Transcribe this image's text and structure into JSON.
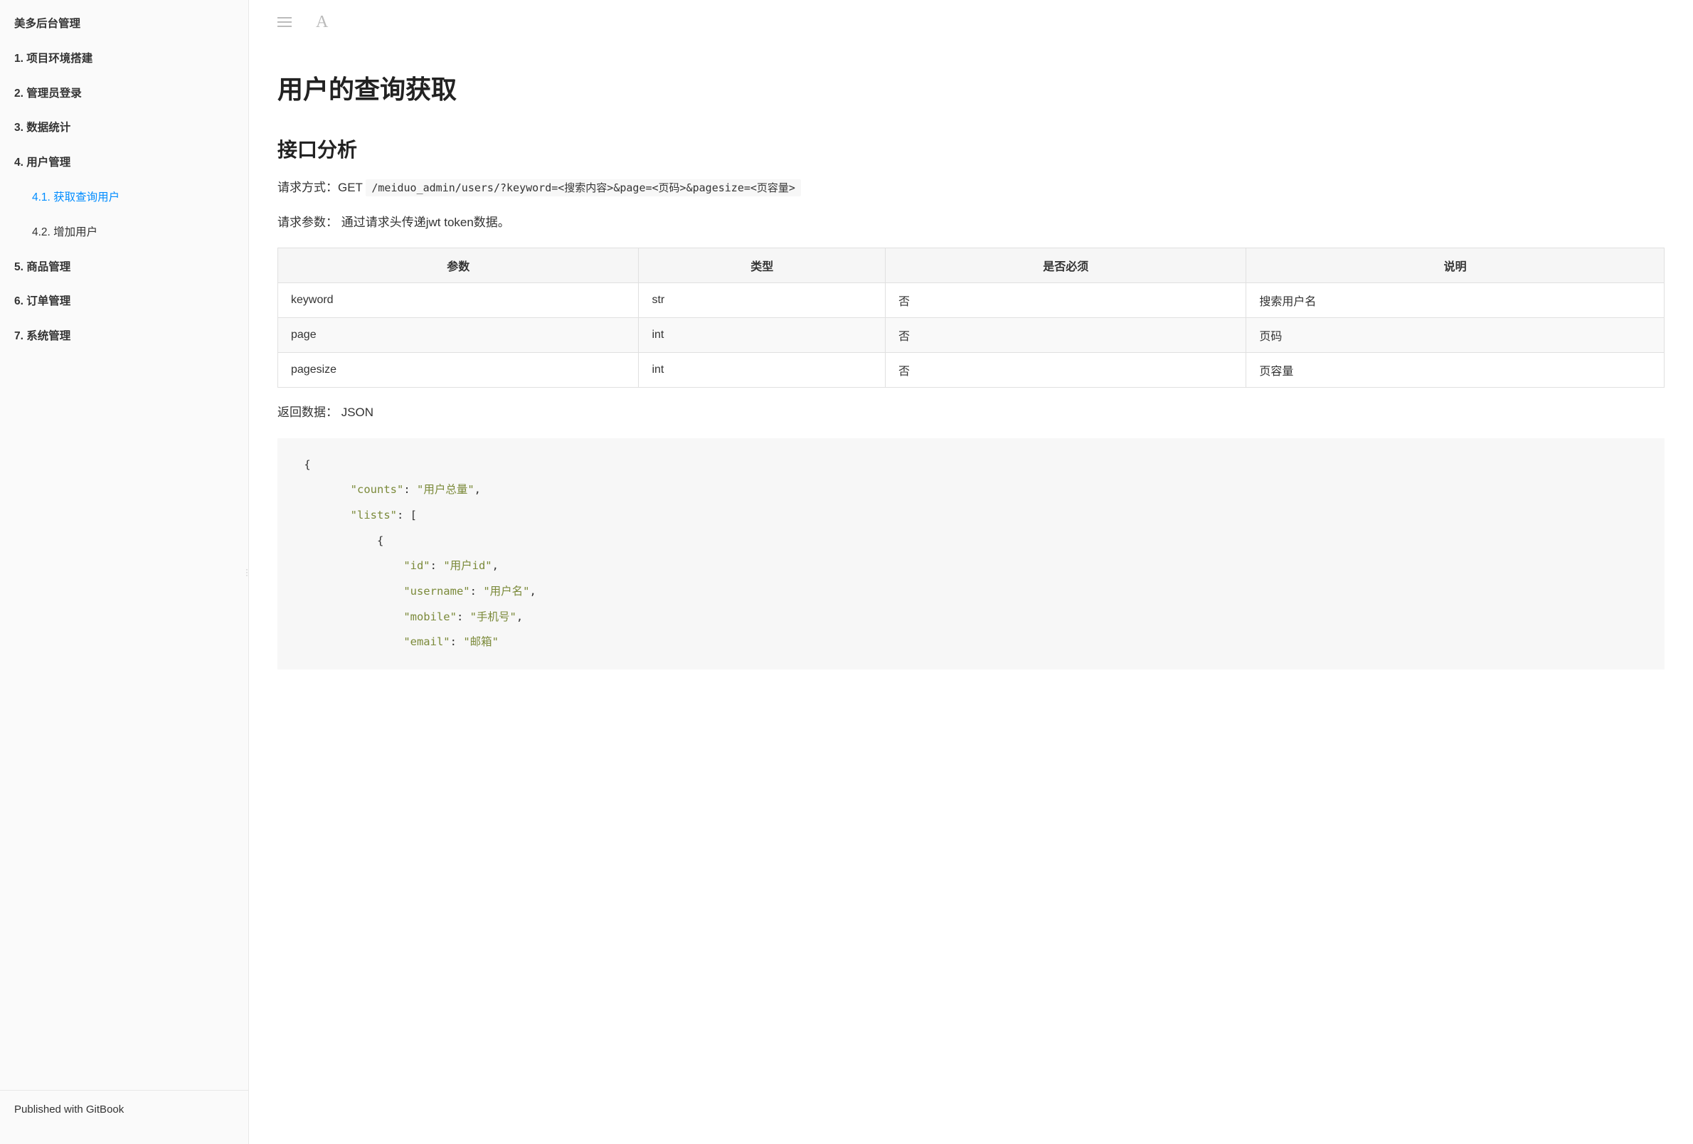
{
  "sidebar": {
    "title": "美多后台管理",
    "items": [
      {
        "label": "1. 项目环境搭建",
        "sub": false,
        "active": false
      },
      {
        "label": "2. 管理员登录",
        "sub": false,
        "active": false
      },
      {
        "label": "3. 数据统计",
        "sub": false,
        "active": false
      },
      {
        "label": "4. 用户管理",
        "sub": false,
        "active": false
      },
      {
        "label": "4.1. 获取查询用户",
        "sub": true,
        "active": true
      },
      {
        "label": "4.2. 增加用户",
        "sub": true,
        "active": false
      },
      {
        "label": "5. 商品管理",
        "sub": false,
        "active": false
      },
      {
        "label": "6. 订单管理",
        "sub": false,
        "active": false
      },
      {
        "label": "7. 系统管理",
        "sub": false,
        "active": false
      }
    ],
    "footer": "Published with GitBook"
  },
  "content": {
    "title": "用户的查询获取",
    "section1": "接口分析",
    "req_method_label": "请求方式：GET ",
    "req_method_code": "/meiduo_admin/users/?keyword=<搜索内容>&page=<页码>&pagesize=<页容量>",
    "req_params_label": "请求参数：  通过请求头传递jwt token数据。",
    "table": {
      "headers": [
        "参数",
        "类型",
        "是否必须",
        "说明"
      ],
      "rows": [
        [
          "keyword",
          "str",
          "否",
          "搜索用户名"
        ],
        [
          "page",
          "int",
          "否",
          "页码"
        ],
        [
          "pagesize",
          "int",
          "否",
          "页容量"
        ]
      ]
    },
    "resp_label": "返回数据：  JSON",
    "code": {
      "open_brace": " {",
      "counts_key": "\"counts\"",
      "counts_val": "\"用户总量\"",
      "lists_key": "\"lists\"",
      "lists_open": "[",
      "item_open": "{",
      "id_key": "\"id\"",
      "id_val": "\"用户id\"",
      "username_key": "\"username\"",
      "username_val": "\"用户名\"",
      "mobile_key": "\"mobile\"",
      "mobile_val": "\"手机号\"",
      "email_key": "\"email\"",
      "email_val": "\"邮箱\""
    }
  }
}
